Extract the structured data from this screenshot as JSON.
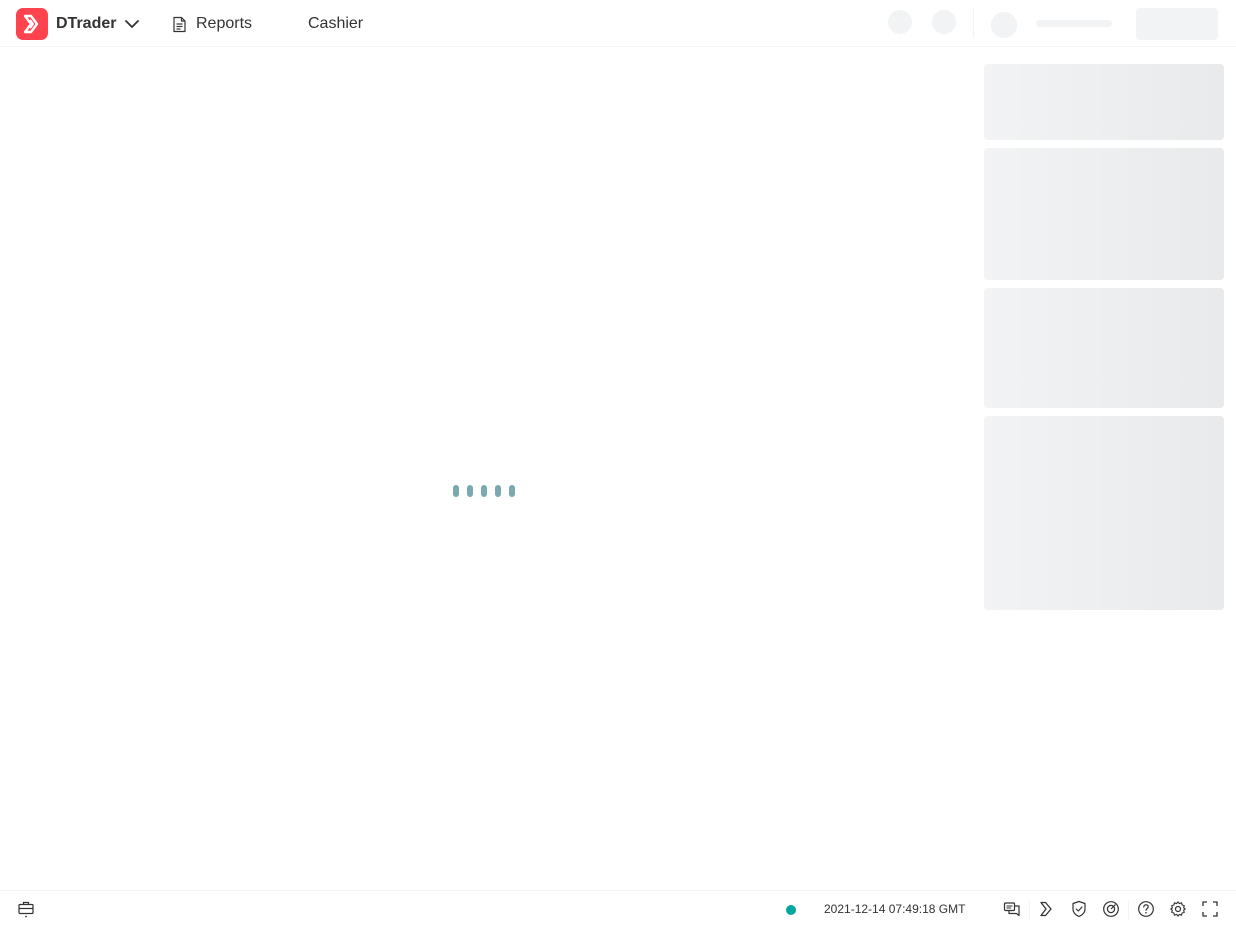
{
  "header": {
    "brand": {
      "name": "DTrader",
      "logo_icon": "deriv-logo-icon",
      "chevron_icon": "chevron-down-icon",
      "brand_color": "#ff444f"
    },
    "nav": [
      {
        "label": "Reports",
        "icon": "reports-icon"
      },
      {
        "label": "Cashier"
      }
    ],
    "loading_placeholders": [
      "notification-placeholder",
      "account-placeholder",
      "avatar-placeholder",
      "balance-placeholder",
      "deposit-button-placeholder"
    ]
  },
  "main": {
    "loader": {
      "state": "loading",
      "dots": 5,
      "color": "#7aa9b0"
    }
  },
  "sidebar": {
    "skeleton_panels": 4
  },
  "footer": {
    "status": {
      "connection": "online",
      "color": "#00a79e"
    },
    "server_time": "2021-12-14 07:49:18 GMT",
    "icons": [
      "positions-icon",
      "chat-icon",
      "deriv-icon",
      "responsible-trading-icon",
      "gambling-help-icon",
      "help-icon",
      "settings-icon",
      "fullscreen-icon"
    ]
  }
}
